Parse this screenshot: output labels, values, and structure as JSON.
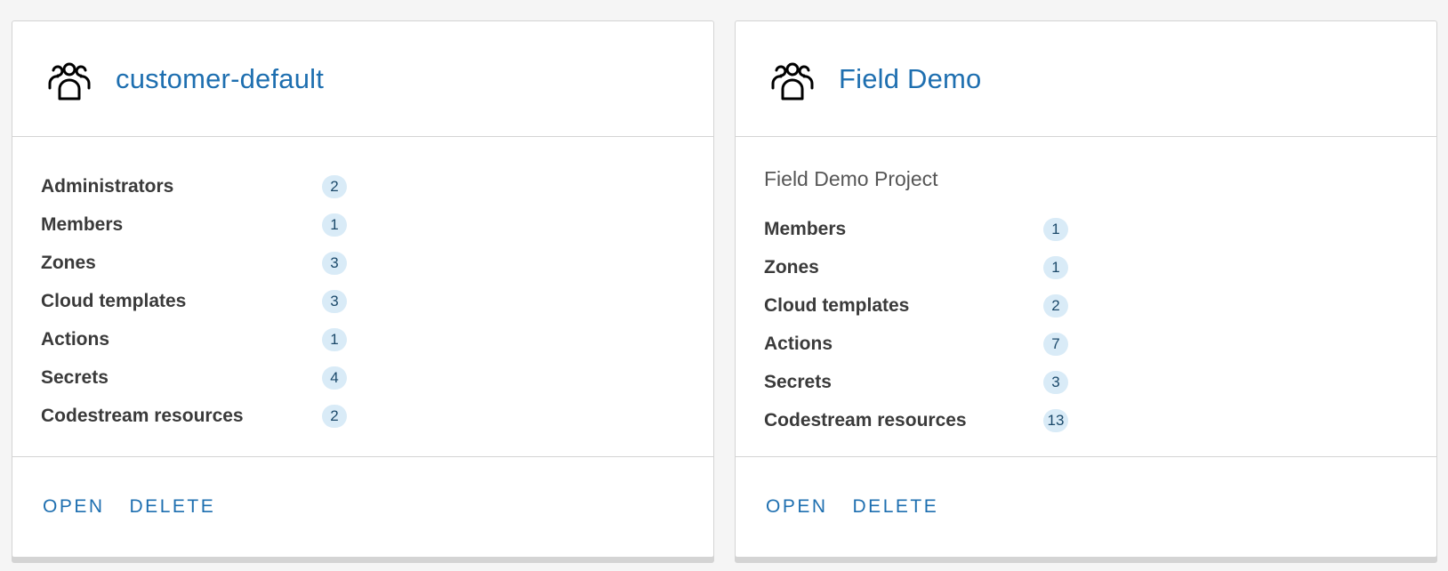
{
  "projects": [
    {
      "icon": "group-icon",
      "title": "customer-default",
      "stats": [
        {
          "label": "Administrators",
          "count": "2"
        },
        {
          "label": "Members",
          "count": "1"
        },
        {
          "label": "Zones",
          "count": "3"
        },
        {
          "label": "Cloud templates",
          "count": "3"
        },
        {
          "label": "Actions",
          "count": "1"
        },
        {
          "label": "Secrets",
          "count": "4"
        },
        {
          "label": "Codestream resources",
          "count": "2"
        }
      ],
      "actions": {
        "open": "OPEN",
        "delete": "DELETE"
      }
    },
    {
      "icon": "group-icon",
      "title": "Field Demo",
      "description": "Field Demo Project",
      "stats": [
        {
          "label": "Members",
          "count": "1"
        },
        {
          "label": "Zones",
          "count": "1"
        },
        {
          "label": "Cloud templates",
          "count": "2"
        },
        {
          "label": "Actions",
          "count": "7"
        },
        {
          "label": "Secrets",
          "count": "3"
        },
        {
          "label": "Codestream resources",
          "count": "13"
        }
      ],
      "actions": {
        "open": "OPEN",
        "delete": "DELETE"
      }
    }
  ],
  "colors": {
    "accent": "#1e6fb0",
    "badge_bg": "#d9ebf7",
    "border": "#d4d4d4",
    "page_bg": "#f5f5f5"
  }
}
